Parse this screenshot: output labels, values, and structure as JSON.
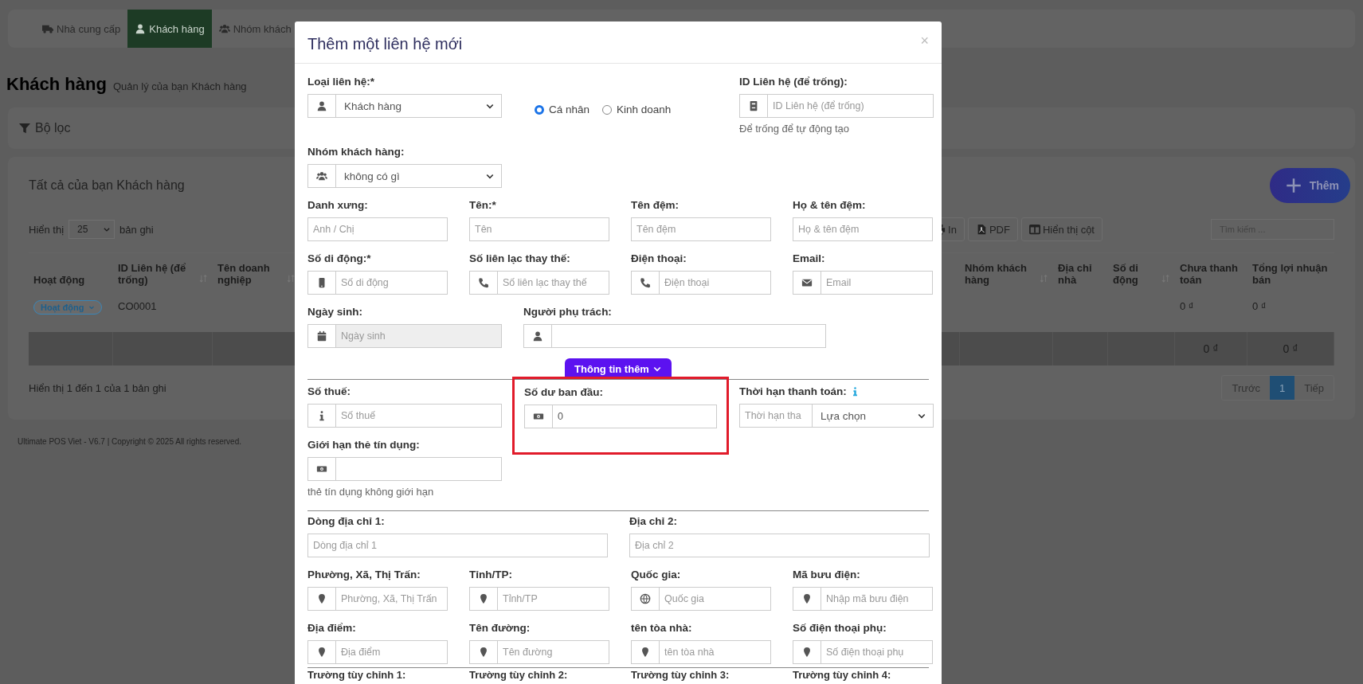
{
  "background": {
    "tabs": [
      {
        "label": "Nhà cung cấp",
        "selected": false
      },
      {
        "label": "Khách hàng",
        "selected": true
      },
      {
        "label": "Nhóm khách",
        "selected": false
      }
    ],
    "page_title": "Khách hàng",
    "page_subtitle": "Quản lý của bạn Khách hàng",
    "filter": "Bộ lọc",
    "card_title": "Tất cả của bạn Khách hàng",
    "add_button": "Thêm",
    "length_before": "Hiển thị",
    "length_value": "25",
    "length_after": "bản ghi",
    "toolbar_buttons": [
      "In",
      "PDF",
      "Hiển thị cột"
    ],
    "search": {
      "placeholder": "Tìm kiếm ..."
    },
    "table": {
      "columns": [
        {
          "label": "Hoạt động",
          "sortable": false
        },
        {
          "label": "ID Liên hệ (để trống)",
          "sortable": true
        },
        {
          "label": "Tên doanh nghiệp",
          "sortable": true
        },
        {
          "label": "Nhóm khách hàng",
          "sortable": true
        },
        {
          "label": "Địa chỉ nhà",
          "sortable": false
        },
        {
          "label": "Số di động",
          "sortable": true
        },
        {
          "label": "Chưa thanh toán",
          "sortable": false
        },
        {
          "label": "Tổng lợi nhuận bán",
          "sortable": false
        }
      ],
      "rows": [
        {
          "status": "Hoạt động",
          "contact_id": "CO0001",
          "unpaid": "0 ₫",
          "total_profit": "0 ₫"
        }
      ],
      "footer": {
        "unpaid": "0 ₫",
        "total_profit": "0 ₫"
      }
    },
    "info": "Hiển thị 1 đến 1 của 1 bản ghi",
    "pagination": [
      {
        "label": "Trước",
        "selected": false
      },
      {
        "label": "1",
        "selected": true
      },
      {
        "label": "Tiếp",
        "selected": false
      }
    ],
    "copyright": "Ultimate POS Viet - V6.7 | Copyright © 2025 All rights reserved."
  },
  "modal": {
    "title": "Thêm một liên hệ mới",
    "close": "×",
    "contact_type": {
      "label": "Loại liên hệ:*",
      "value": "Khách hàng"
    },
    "radios": [
      {
        "label": "Cá nhân",
        "selected": true
      },
      {
        "label": "Kinh doanh",
        "selected": false
      }
    ],
    "contact_id": {
      "label": "ID Liên hệ (để trống):",
      "placeholder": "ID Liên hệ (để trống)",
      "help": "Để trống để tự động tạo"
    },
    "customer_group": {
      "label": "Nhóm khách hàng:",
      "value": "không có gì"
    },
    "name_fields": [
      {
        "label": "Danh xưng:",
        "placeholder": "Anh / Chị"
      },
      {
        "label": "Tên:*",
        "placeholder": "Tên"
      },
      {
        "label": "Tên đệm:",
        "placeholder": "Tên đệm"
      },
      {
        "label": "Họ & tên đệm:",
        "placeholder": "Họ & tên đệm"
      }
    ],
    "contact_fields": [
      {
        "label": "Số di động:*",
        "placeholder": "Số di động"
      },
      {
        "label": "Số liên lạc thay thế:",
        "placeholder": "Số liên lạc thay thế"
      },
      {
        "label": "Điện thoại:",
        "placeholder": "Điện thoại"
      },
      {
        "label": "Email:",
        "placeholder": "Email"
      }
    ],
    "dob": {
      "label": "Ngày sinh:",
      "placeholder": "Ngày sinh",
      "disabled": true
    },
    "assigned_to": {
      "label": "Người phụ trách:"
    },
    "more_button": "Thông tin thêm",
    "tax": {
      "label": "Số thuế:",
      "placeholder": "Số thuế"
    },
    "opening_balance": {
      "label": "Số dư ban đầu:",
      "value": "0",
      "highlighted": true
    },
    "pay_term": {
      "label": "Thời hạn thanh toán:",
      "placeholder": "Thời hạn tha",
      "select_value": "Lựa chọn"
    },
    "credit_limit": {
      "label": "Giới hạn thẻ tín dụng:",
      "help": "thẻ tín dụng không giới hạn"
    },
    "address_fields": [
      {
        "label": "Dòng địa chỉ 1:",
        "placeholder": "Dòng địa chỉ 1"
      },
      {
        "label": "Địa chỉ 2:",
        "placeholder": "Địa chỉ 2"
      }
    ],
    "location_fields": [
      {
        "label": "Phường, Xã, Thị Trấn:",
        "placeholder": "Phường, Xã, Thị Trấn"
      },
      {
        "label": "Tỉnh/TP:",
        "placeholder": "Tỉnh/TP"
      },
      {
        "label": "Quốc gia:",
        "placeholder": "Quốc gia"
      },
      {
        "label": "Mã bưu điện:",
        "placeholder": "Nhập mã bưu điện"
      },
      {
        "label": "Địa điểm:",
        "placeholder": "Địa điểm"
      },
      {
        "label": "Tên đường:",
        "placeholder": "Tên đường"
      },
      {
        "label": "tên tòa nhà:",
        "placeholder": "tên tòa nhà"
      },
      {
        "label": "Số điện thoại phụ:",
        "placeholder": "Số điện thoại phụ"
      }
    ],
    "custom_field_labels": [
      "Trường tùy chỉnh 1:",
      "Trường tùy chỉnh 2:",
      "Trường tùy chỉnh 3:",
      "Trường tùy chỉnh 4:"
    ]
  }
}
